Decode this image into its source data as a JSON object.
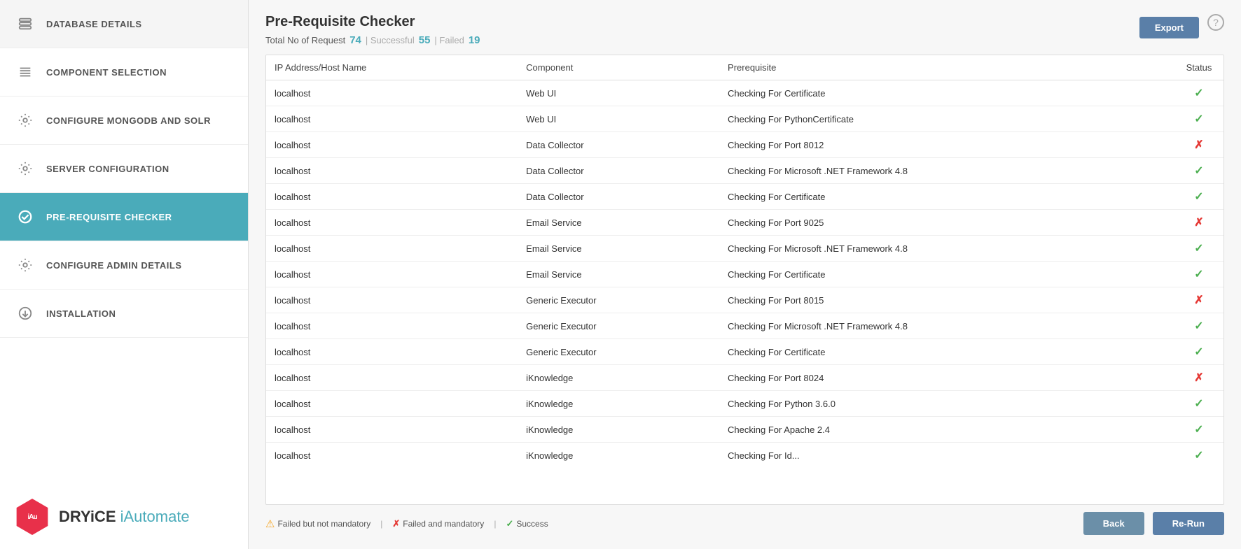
{
  "sidebar": {
    "items": [
      {
        "id": "database-details",
        "label": "DATABASE DETAILS",
        "icon": "database-icon",
        "active": false
      },
      {
        "id": "component-selection",
        "label": "COMPONENT SELECTION",
        "icon": "list-icon",
        "active": false
      },
      {
        "id": "configure-mongodb",
        "label": "CONFIGURE MONGODB AND SOLR",
        "icon": "gear-icon",
        "active": false
      },
      {
        "id": "server-configuration",
        "label": "SERVER CONFIGURATION",
        "icon": "gear-icon",
        "active": false
      },
      {
        "id": "pre-requisite-checker",
        "label": "PRE-REQUISITE CHECKER",
        "icon": "check-icon",
        "active": true
      },
      {
        "id": "configure-admin",
        "label": "CONFIGURE ADMIN DETAILS",
        "icon": "gear-icon",
        "active": false
      },
      {
        "id": "installation",
        "label": "INSTALLATION",
        "icon": "download-icon",
        "active": false
      }
    ],
    "logo_prefix": "iAu",
    "logo_brand": "DRYiCE",
    "logo_product": " iAutomate"
  },
  "main": {
    "title": "Pre-Requisite Checker",
    "stats": {
      "label_total": "Total No of Request",
      "total": "74",
      "sep1": "| Successful",
      "successful": "55",
      "sep2": "| Failed",
      "failed": "19"
    },
    "export_label": "Export",
    "table": {
      "headers": [
        "IP Address/Host Name",
        "Component",
        "Prerequisite",
        "Status"
      ],
      "rows": [
        {
          "ip": "localhost",
          "component": "Web UI",
          "prerequisite": "Checking For Certificate",
          "status": "check"
        },
        {
          "ip": "localhost",
          "component": "Web UI",
          "prerequisite": "Checking For PythonCertificate",
          "status": "check"
        },
        {
          "ip": "localhost",
          "component": "Data Collector",
          "prerequisite": "Checking For Port 8012",
          "status": "x"
        },
        {
          "ip": "localhost",
          "component": "Data Collector",
          "prerequisite": "Checking For Microsoft .NET Framework 4.8",
          "status": "check"
        },
        {
          "ip": "localhost",
          "component": "Data Collector",
          "prerequisite": "Checking For Certificate",
          "status": "check"
        },
        {
          "ip": "localhost",
          "component": "Email Service",
          "prerequisite": "Checking For Port 9025",
          "status": "x"
        },
        {
          "ip": "localhost",
          "component": "Email Service",
          "prerequisite": "Checking For Microsoft .NET Framework 4.8",
          "status": "check"
        },
        {
          "ip": "localhost",
          "component": "Email Service",
          "prerequisite": "Checking For Certificate",
          "status": "check"
        },
        {
          "ip": "localhost",
          "component": "Generic Executor",
          "prerequisite": "Checking For Port 8015",
          "status": "x"
        },
        {
          "ip": "localhost",
          "component": "Generic Executor",
          "prerequisite": "Checking For Microsoft .NET Framework 4.8",
          "status": "check"
        },
        {
          "ip": "localhost",
          "component": "Generic Executor",
          "prerequisite": "Checking For Certificate",
          "status": "check"
        },
        {
          "ip": "localhost",
          "component": "iKnowledge",
          "prerequisite": "Checking For Port 8024",
          "status": "x"
        },
        {
          "ip": "localhost",
          "component": "iKnowledge",
          "prerequisite": "Checking For Python 3.6.0",
          "status": "check"
        },
        {
          "ip": "localhost",
          "component": "iKnowledge",
          "prerequisite": "Checking For Apache 2.4",
          "status": "check"
        },
        {
          "ip": "localhost",
          "component": "iKnowledge",
          "prerequisite": "Checking For Id...",
          "status": "check"
        }
      ]
    },
    "legend": {
      "warning_text": "Failed but not mandatory",
      "sep1": "|",
      "x_text": "Failed and mandatory",
      "sep2": "|",
      "check_text": "Success"
    },
    "back_label": "Back",
    "rerun_label": "Re-Run"
  }
}
